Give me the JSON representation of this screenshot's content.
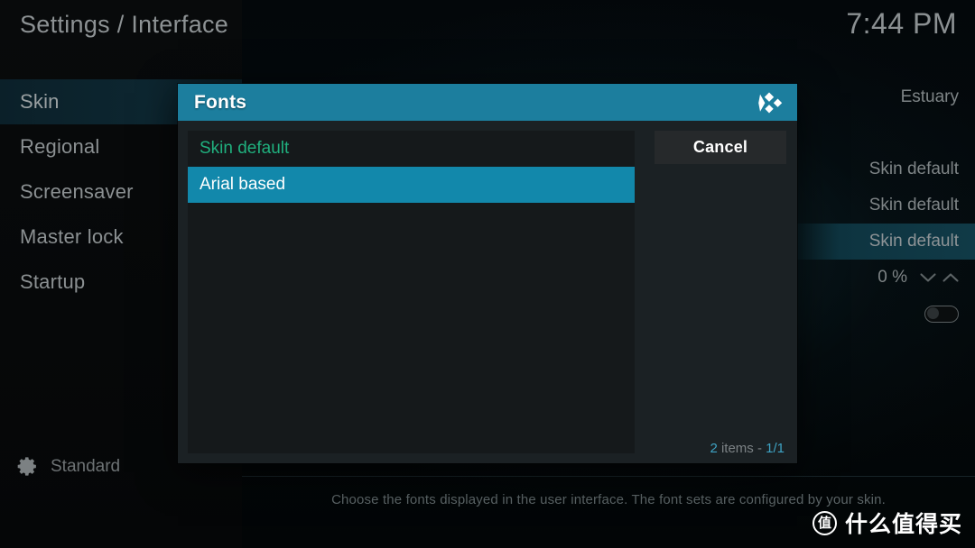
{
  "header": {
    "breadcrumb": "Settings / Interface",
    "clock": "7:44 PM"
  },
  "sidebar": {
    "items": [
      {
        "label": "Skin"
      },
      {
        "label": "Regional"
      },
      {
        "label": "Screensaver"
      },
      {
        "label": "Master lock"
      },
      {
        "label": "Startup"
      }
    ],
    "settings_level": {
      "icon": "gear-icon",
      "label": "Standard"
    }
  },
  "settings_panel": {
    "rows": [
      {
        "value": "Estuary",
        "control": "none"
      },
      {
        "value": "",
        "control": "none"
      },
      {
        "value": "Skin default",
        "control": "none"
      },
      {
        "value": "Skin default",
        "control": "none"
      },
      {
        "value": "Skin default",
        "control": "none"
      },
      {
        "value": "0 %",
        "control": "spinner"
      },
      {
        "value": "",
        "control": "toggle"
      }
    ]
  },
  "dialog": {
    "title": "Fonts",
    "logo": "kodi-logo",
    "cancel_label": "Cancel",
    "options": [
      {
        "label": "Skin default",
        "state": "current"
      },
      {
        "label": "Arial based",
        "state": "focused"
      }
    ],
    "count": {
      "total": "2",
      "items_text": "items -",
      "page": "1/1"
    }
  },
  "footer": {
    "description": "Choose the fonts displayed in the user interface. The font sets are configured by your skin."
  },
  "watermark": {
    "badge": "值",
    "text": "什么值得买"
  },
  "colors": {
    "accent": "#1c7e9e",
    "focus": "#1288ab",
    "current_value": "#20b07e",
    "count_num": "#3ea3c4"
  }
}
